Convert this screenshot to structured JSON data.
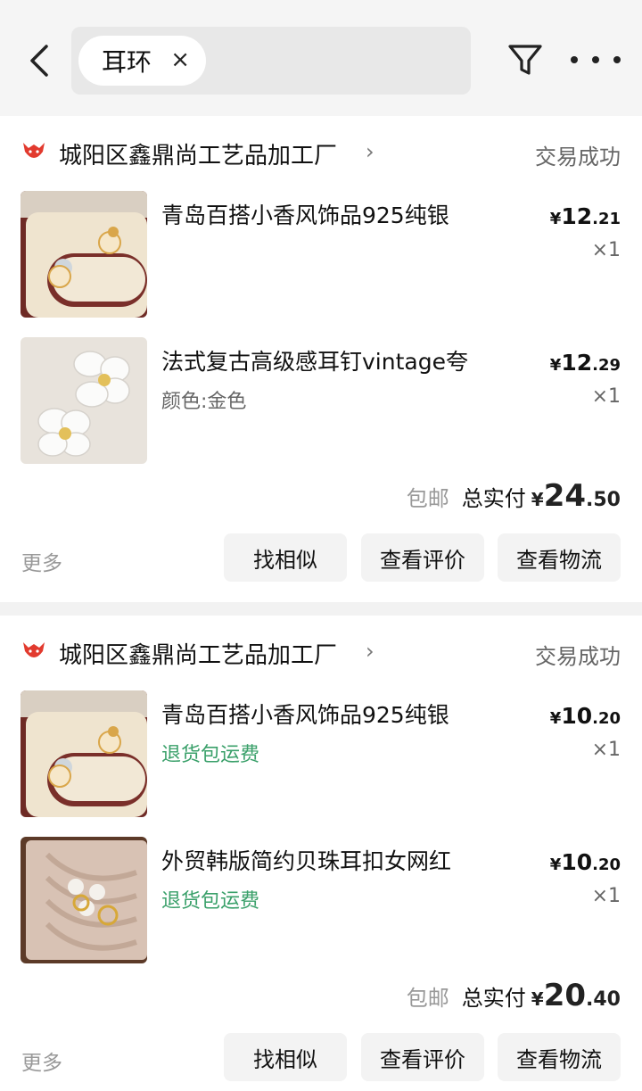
{
  "header": {
    "back_icon": "chevron-left-icon",
    "search_chip": {
      "label": "耳环",
      "close": "×"
    },
    "filter_icon": "funnel-icon",
    "more_icon": "ellipsis-icon"
  },
  "orders": [
    {
      "shop_name": "城阳区鑫鼎尚工艺品加工厂",
      "shop_chevron": "›",
      "status": "交易成功",
      "items": [
        {
          "title": "青岛百搭小香风饰品925纯银",
          "subtitle": "",
          "price_currency": "¥",
          "price_int": "12",
          "price_dec": ".21",
          "qty": "×1"
        },
        {
          "title": "法式复古高级感耳钉vintage夸",
          "subtitle": "颜色:金色",
          "price_currency": "¥",
          "price_int": "12",
          "price_dec": ".29",
          "qty": "×1"
        }
      ],
      "shipping": "包邮",
      "total_label": "总实付",
      "total_currency": "¥",
      "total_int": "24",
      "total_dec": ".50",
      "more": "更多",
      "buttons": [
        "找相似",
        "查看评价",
        "查看物流"
      ]
    },
    {
      "shop_name": "城阳区鑫鼎尚工艺品加工厂",
      "shop_chevron": "›",
      "status": "交易成功",
      "items": [
        {
          "title": "青岛百搭小香风饰品925纯银",
          "subtitle": "退货包运费",
          "price_currency": "¥",
          "price_int": "10",
          "price_dec": ".20",
          "qty": "×1"
        },
        {
          "title": "外贸韩版简约贝珠耳扣女网红",
          "subtitle": "退货包运费",
          "price_currency": "¥",
          "price_int": "10",
          "price_dec": ".20",
          "qty": "×1"
        }
      ],
      "shipping": "包邮",
      "total_label": "总实付",
      "total_currency": "¥",
      "total_int": "20",
      "total_dec": ".40",
      "more": "更多",
      "buttons": [
        "找相似",
        "查看评价",
        "查看物流"
      ]
    }
  ],
  "colors": {
    "accent_red": "#e23a2e",
    "return_green": "#3aa06a"
  }
}
